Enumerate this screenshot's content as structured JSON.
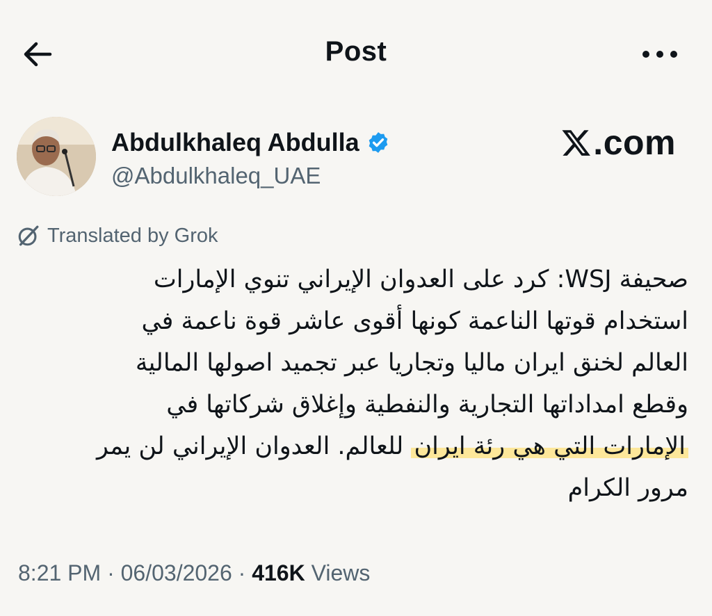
{
  "header": {
    "title": "Post"
  },
  "author": {
    "name": "Abdulkhaleq Abdulla",
    "handle": "@Abdulkhaleq_UAE",
    "verified": true
  },
  "brand": {
    "label": ".com"
  },
  "translation": {
    "label": "Translated by Grok"
  },
  "post": {
    "lines": [
      "صحيفة WSJ: كرد على العدوان الإيراني تنوي الإمارات",
      "استخدام قوتها الناعمة كونها أقوى عاشر قوة ناعمة في",
      "العالم لخنق ايران ماليا وتجاريا عبر تجميد اصولها المالية",
      "وقطع امداداتها التجارية والنفطية وإغلاق شركاتها في",
      "للعالم. العدوان الإيراني لن يمر",
      "مرور الكرام"
    ],
    "highlighted": "الإمارات التي هي رئة ايران"
  },
  "meta": {
    "time": "8:21 PM",
    "separator": " · ",
    "date": "06/03/2026",
    "views_count": "416K",
    "views_label": "Views"
  },
  "colors": {
    "background": "#f7f6f3",
    "text": "#0f1419",
    "secondary": "#536471",
    "verified": "#1d9bf0",
    "highlight": "#fde79a"
  },
  "icons": [
    "back-arrow-icon",
    "more-icon",
    "verified-badge-icon",
    "x-logo-icon",
    "grok-icon"
  ]
}
